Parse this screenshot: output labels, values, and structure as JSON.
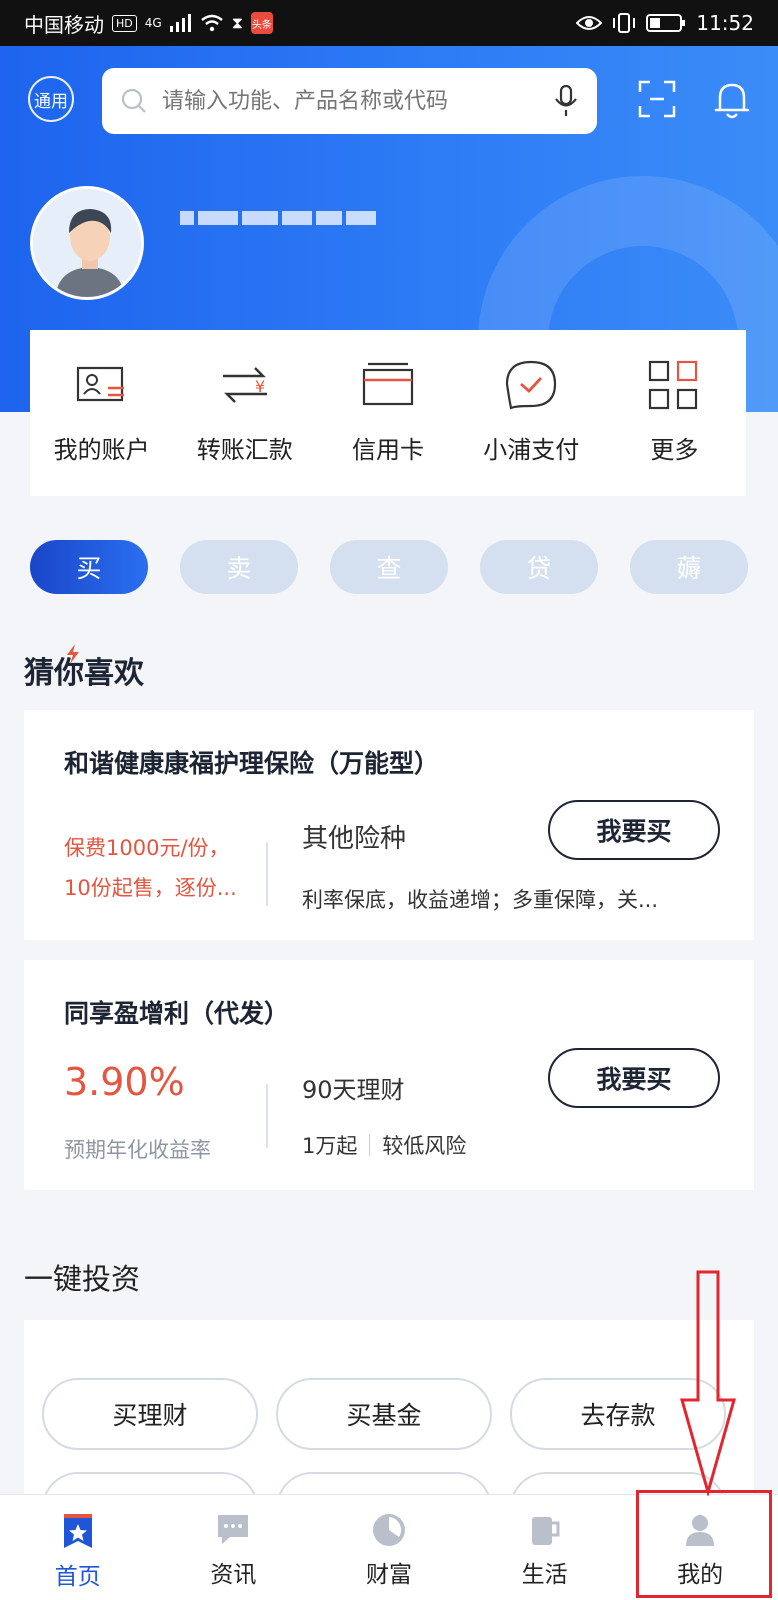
{
  "status_bar": {
    "carrier": "中国移动",
    "hd": "HD",
    "network": "4G",
    "app_badge": "头条",
    "time": "11:52"
  },
  "header": {
    "mode_label": "通用",
    "search_placeholder": "请输入功能、产品名称或代码"
  },
  "quick_actions": [
    {
      "label": "我的账户",
      "icon": "account-card-icon"
    },
    {
      "label": "转账汇款",
      "icon": "transfer-icon"
    },
    {
      "label": "信用卡",
      "icon": "credit-card-icon"
    },
    {
      "label": "小浦支付",
      "icon": "pay-bubble-icon"
    },
    {
      "label": "更多",
      "icon": "grid-more-icon"
    }
  ],
  "segment_tabs": [
    {
      "label": "买",
      "active": true
    },
    {
      "label": "卖",
      "active": false
    },
    {
      "label": "查",
      "active": false
    },
    {
      "label": "贷",
      "active": false
    },
    {
      "label": "薅",
      "active": false
    }
  ],
  "recommend": {
    "title": "猜你喜欢",
    "products": [
      {
        "name": "和谐健康康福护理保险（万能型）",
        "left_line1": "保费1000元/份，",
        "left_line2": "10份起售，逐份...",
        "category": "其他险种",
        "desc": "利率保底，收益递增；多重保障，关...",
        "button": "我要买"
      },
      {
        "name": "同享盈增利（代发）",
        "rate": "3.90%",
        "rate_label": "预期年化收益率",
        "term": "90天理财",
        "min": "1万起",
        "risk": "较低风险",
        "button": "我要买"
      }
    ]
  },
  "invest": {
    "title": "一键投资",
    "pills": [
      "买理财",
      "买基金",
      "去存款"
    ]
  },
  "bottom_nav": [
    {
      "label": "首页",
      "icon": "home-star-icon",
      "active": true
    },
    {
      "label": "资讯",
      "icon": "chat-bubble-icon",
      "active": false
    },
    {
      "label": "财富",
      "icon": "pie-chart-icon",
      "active": false
    },
    {
      "label": "生活",
      "icon": "cup-icon",
      "active": false
    },
    {
      "label": "我的",
      "icon": "person-icon",
      "active": false
    }
  ],
  "colors": {
    "primary": "#1f56d8",
    "accent_red": "#e5553f",
    "annotation_red": "#e2262f"
  }
}
